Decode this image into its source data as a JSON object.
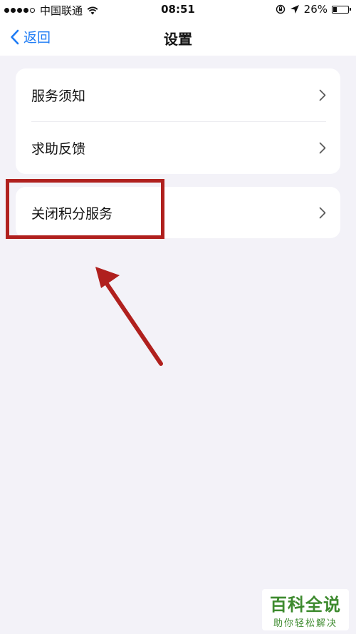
{
  "status_bar": {
    "carrier": "中国联通",
    "time": "08:51",
    "battery_percent": "26%",
    "battery_level": 0.26,
    "signal_bars": 4,
    "signal_total": 5
  },
  "nav": {
    "back_label": "返回",
    "title": "设置",
    "accent_color": "#1f7cf5"
  },
  "settings": {
    "group1": [
      {
        "label": "服务须知"
      },
      {
        "label": "求助反馈"
      }
    ],
    "group2": [
      {
        "label": "关闭积分服务"
      }
    ]
  },
  "annotation": {
    "highlight_color": "#b0201e",
    "target": "关闭积分服务"
  },
  "watermark": {
    "main": "百科全说",
    "sub": "助你轻松解决"
  }
}
